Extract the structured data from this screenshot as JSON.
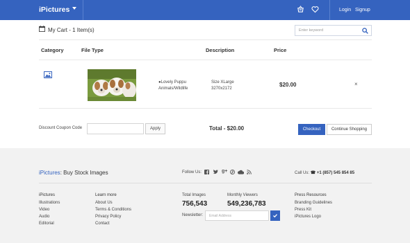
{
  "colors": {
    "brand": "#3563bf",
    "footer_bg": "#f2f2f2"
  },
  "header": {
    "brand": "iPictures",
    "login": "Login",
    "signup": "Signup",
    "icons": [
      "chevron-down-icon",
      "cart-icon",
      "heart-icon"
    ]
  },
  "cart": {
    "title": "My Cart - 1 Item(s)",
    "search_placeholder": "Enter keyword",
    "columns": [
      "Category",
      "File Type",
      "Description",
      "Price"
    ],
    "items": [
      {
        "category_icon": "image-icon",
        "title_line1": "●Lovely Puppu",
        "title_line2": "Animals/Wildlife",
        "size_line1": "Size XLarge",
        "size_line2": "3270x2172",
        "price": "$20.00",
        "remove": "×"
      }
    ],
    "coupon_label": "Discount Coupon Code",
    "apply": "Apply",
    "total": "Total - $20.00",
    "checkout": "Checkout",
    "continue": "Continue Shopping"
  },
  "footer": {
    "brand_main": "iPictures",
    "brand_sub": ": Buy Stock Images",
    "follow": "Follow Us:",
    "social_icons": [
      "facebook-icon",
      "twitter-icon",
      "google-plus-icon",
      "pinterest-icon",
      "cloud-icon",
      "rss-icon"
    ],
    "call_label": "Call Us:",
    "phone": "☎ +1 (857) 545 854 85",
    "col1": {
      "head": "iPictures",
      "items": [
        "Illustrations",
        "Video",
        "Audio",
        "Editorial"
      ]
    },
    "col2": {
      "head": "Learn more",
      "items": [
        "About Us",
        "Terms & Conditions",
        "Privacy Policy",
        "Contact"
      ]
    },
    "stats": [
      {
        "label": "Total Images",
        "value": "756,543"
      },
      {
        "label": "Monthly Viewers",
        "value": "549,236,783"
      }
    ],
    "newsletter_label": "Newsletter:",
    "newsletter_placeholder": "Email Address",
    "col4": {
      "head": "Press Resources",
      "items": [
        "Branding Guidelines",
        "Press Kit",
        "iPictures Logo"
      ]
    }
  }
}
